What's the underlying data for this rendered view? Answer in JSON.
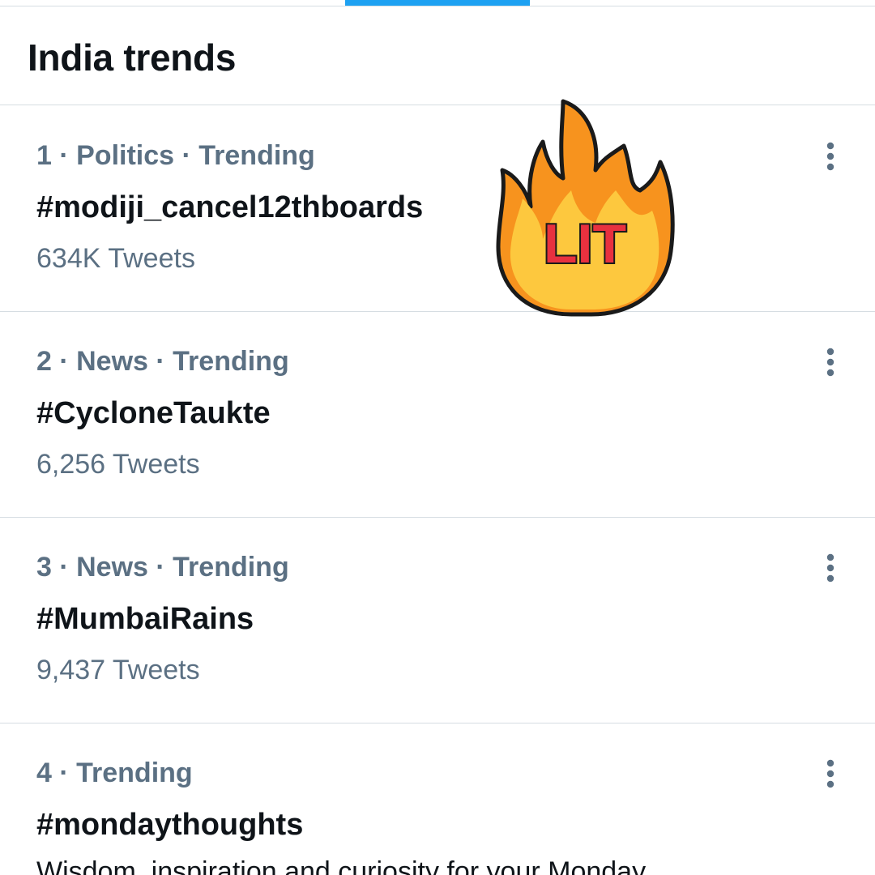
{
  "header": {
    "title": "India trends"
  },
  "colors": {
    "accent": "#1da1f2",
    "text_primary": "#0f1419",
    "text_secondary": "#5b7083",
    "divider": "#d6dde2"
  },
  "trends": [
    {
      "meta": "1 · Politics · Trending",
      "name": "#modiji_cancel12thboards",
      "count": "634K Tweets"
    },
    {
      "meta": "2 · News · Trending",
      "name": "#CycloneTaukte",
      "count": "6,256 Tweets"
    },
    {
      "meta": "3 · News · Trending",
      "name": "#MumbaiRains",
      "count": "9,437 Tweets"
    },
    {
      "meta": "4 · Trending",
      "name": "#mondaythoughts",
      "description": "Wisdom, inspiration and curiosity for your Monday"
    }
  ],
  "sticker": {
    "text": "LIT",
    "icon": "fire-icon"
  },
  "icons": {
    "more": "more-vertical-icon"
  }
}
